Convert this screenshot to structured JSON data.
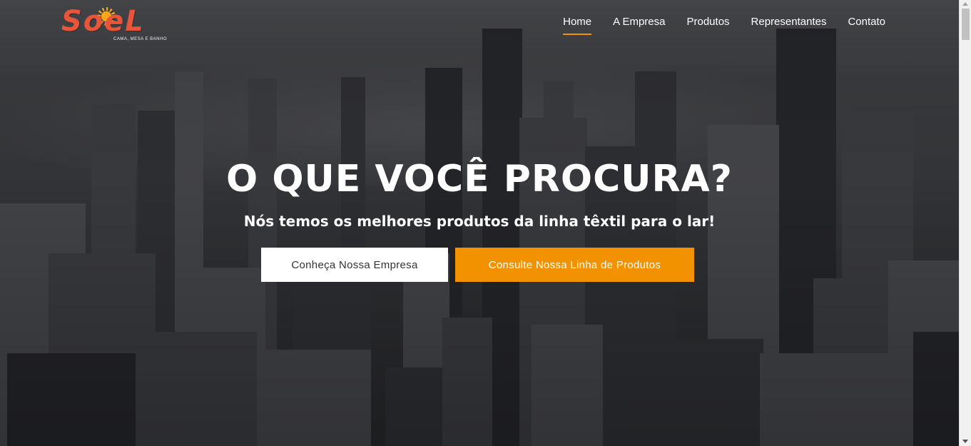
{
  "logo": {
    "word": "SoeL",
    "tagline": "CAMA, MESA E BANHO"
  },
  "nav": {
    "items": [
      {
        "label": "Home",
        "active": true
      },
      {
        "label": "A Empresa",
        "active": false
      },
      {
        "label": "Produtos",
        "active": false
      },
      {
        "label": "Representantes",
        "active": false
      },
      {
        "label": "Contato",
        "active": false
      }
    ]
  },
  "hero": {
    "title": "O QUE VOCÊ PROCURA?",
    "subtitle": "Nós temos os melhores produtos da linha têxtil para o lar!",
    "buttons": {
      "primary_label": "Conheça Nossa Empresa",
      "secondary_label": "Consulte Nossa Linha de Produtos"
    }
  },
  "colors": {
    "accent": "#f39200",
    "logo": "#e8553a",
    "overlay": "#2c2d30"
  }
}
